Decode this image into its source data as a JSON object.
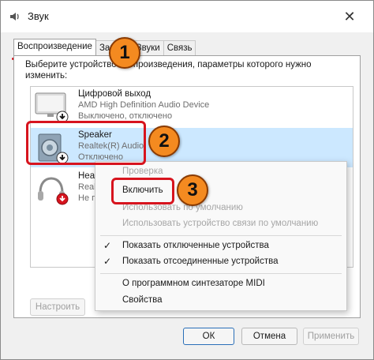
{
  "window": {
    "title": "Звук"
  },
  "tabs": [
    {
      "label": "Воспроизведение"
    },
    {
      "label": "Запись"
    },
    {
      "label": "Звуки"
    },
    {
      "label": "Связь"
    }
  ],
  "panel": {
    "prompt": "Выберите устройство воспроизведения, параметры которого нужно изменить:"
  },
  "devices": [
    {
      "name": "Цифровой выход",
      "driver": "AMD High Definition Audio Device",
      "status": "Выключено, отключено"
    },
    {
      "name": "Speaker",
      "driver": "Realtek(R) Audio",
      "status": "Отключено"
    },
    {
      "name": "Headphones",
      "driver": "Realtek(R) Audio",
      "status": "Не подключено"
    }
  ],
  "context_menu": {
    "items": [
      {
        "label": "Проверка",
        "enabled": false,
        "checked": false
      },
      {
        "label": "Включить",
        "enabled": true,
        "checked": false
      },
      {
        "label": "Использовать по умолчанию",
        "enabled": false,
        "checked": false
      },
      {
        "label": "Использовать устройство связи по умолчанию",
        "enabled": false,
        "checked": false
      },
      {
        "label": "Показать отключенные устройства",
        "enabled": true,
        "checked": true
      },
      {
        "label": "Показать отсоединенные устройства",
        "enabled": true,
        "checked": true
      },
      {
        "label": "О программном синтезаторе MIDI",
        "enabled": true,
        "checked": false
      },
      {
        "label": "Свойства",
        "enabled": true,
        "checked": false
      }
    ]
  },
  "buttons": {
    "configure": "Настроить",
    "ok": "ОК",
    "cancel": "Отмена",
    "apply": "Применить"
  },
  "callouts": [
    "1",
    "2",
    "3"
  ],
  "icons": {
    "title": "speaker-icon",
    "close": "close-icon",
    "monitor": "monitor-icon",
    "speaker": "speaker-icon",
    "headphones": "headphones-icon",
    "disabled_badge": "down-arrow-badge-icon",
    "check": "check-icon"
  },
  "colors": {
    "highlight": "#d7141e",
    "callout": "#f48a20",
    "selection": "#cce8ff"
  }
}
